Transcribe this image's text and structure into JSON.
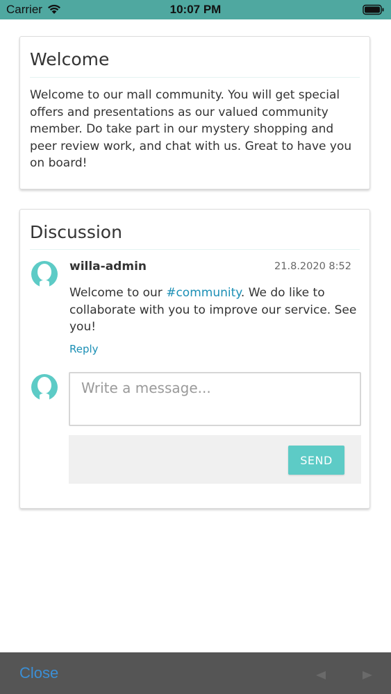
{
  "status_bar": {
    "carrier": "Carrier",
    "time": "10:07 PM",
    "bg_color": "#4fa8a0"
  },
  "welcome": {
    "title": "Welcome",
    "body": "Welcome to our mall community. You will get special offers and presentations as our valued community member. Do take part in our mystery shopping and peer review work, and chat with us. Great to have you on board!"
  },
  "discussion": {
    "title": "Discussion",
    "post": {
      "author": "willa-admin",
      "timestamp": "21.8.2020 8:52",
      "text_before": "Welcome to our ",
      "hashtag": "#community",
      "text_after": ". We do like to collaborate with you to improve our service. See you!",
      "reply_label": "Reply"
    },
    "composer": {
      "placeholder": "Write a message...",
      "send_label": "SEND"
    }
  },
  "bottom_bar": {
    "close_label": "Close"
  },
  "colors": {
    "accent": "#5dcbc6",
    "link": "#1b8fb5",
    "avatar": "#5dcbc6"
  },
  "icons": {
    "wifi": "wifi-icon",
    "battery": "battery-icon",
    "avatar": "user-avatar-icon",
    "back": "back-arrow-icon",
    "forward": "forward-arrow-icon"
  }
}
